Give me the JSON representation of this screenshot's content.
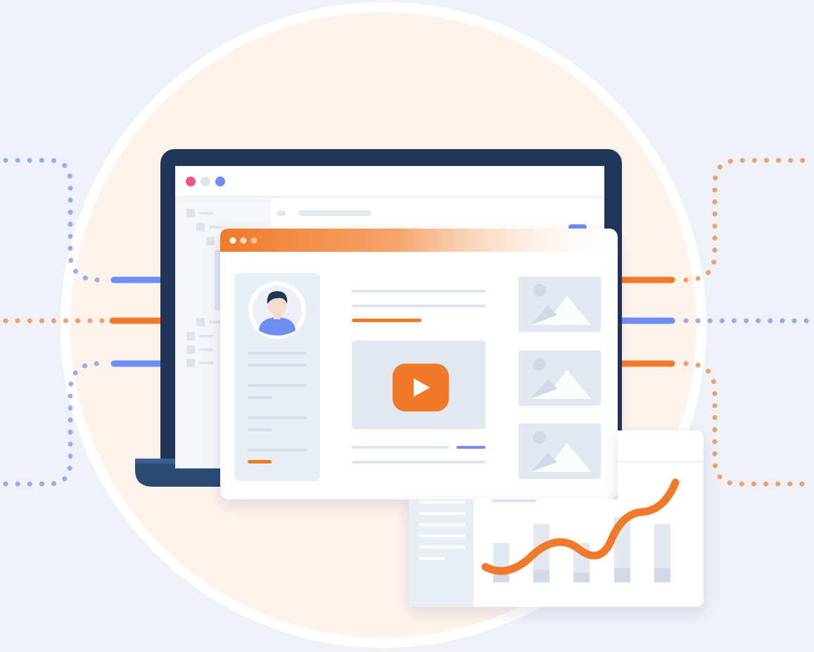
{
  "colors": {
    "background": "#eef2f7",
    "circle_fill": "#fdf2ec",
    "circle_ring": "#ffffff",
    "laptop_frame": "#1f3657",
    "laptop_base": "#2a4a75",
    "accent_orange": "#f07a2a",
    "accent_blue": "#6d8cf4",
    "placeholder_gray": "#e3e8f0",
    "line_gray": "#dfe4ec"
  },
  "icons": {
    "window_controls": [
      "close-dot",
      "minimize-dot",
      "maximize-dot"
    ],
    "avatar": "user-avatar-icon",
    "video": "play-icon",
    "images": [
      "image-placeholder-icon",
      "image-placeholder-icon",
      "image-placeholder-icon"
    ],
    "chart": "trend-line-chart"
  },
  "analytics_widget": {
    "bar_levels": [
      0.55,
      0.8,
      0.55,
      0.9,
      0.8
    ],
    "trend_direction": "rising"
  }
}
